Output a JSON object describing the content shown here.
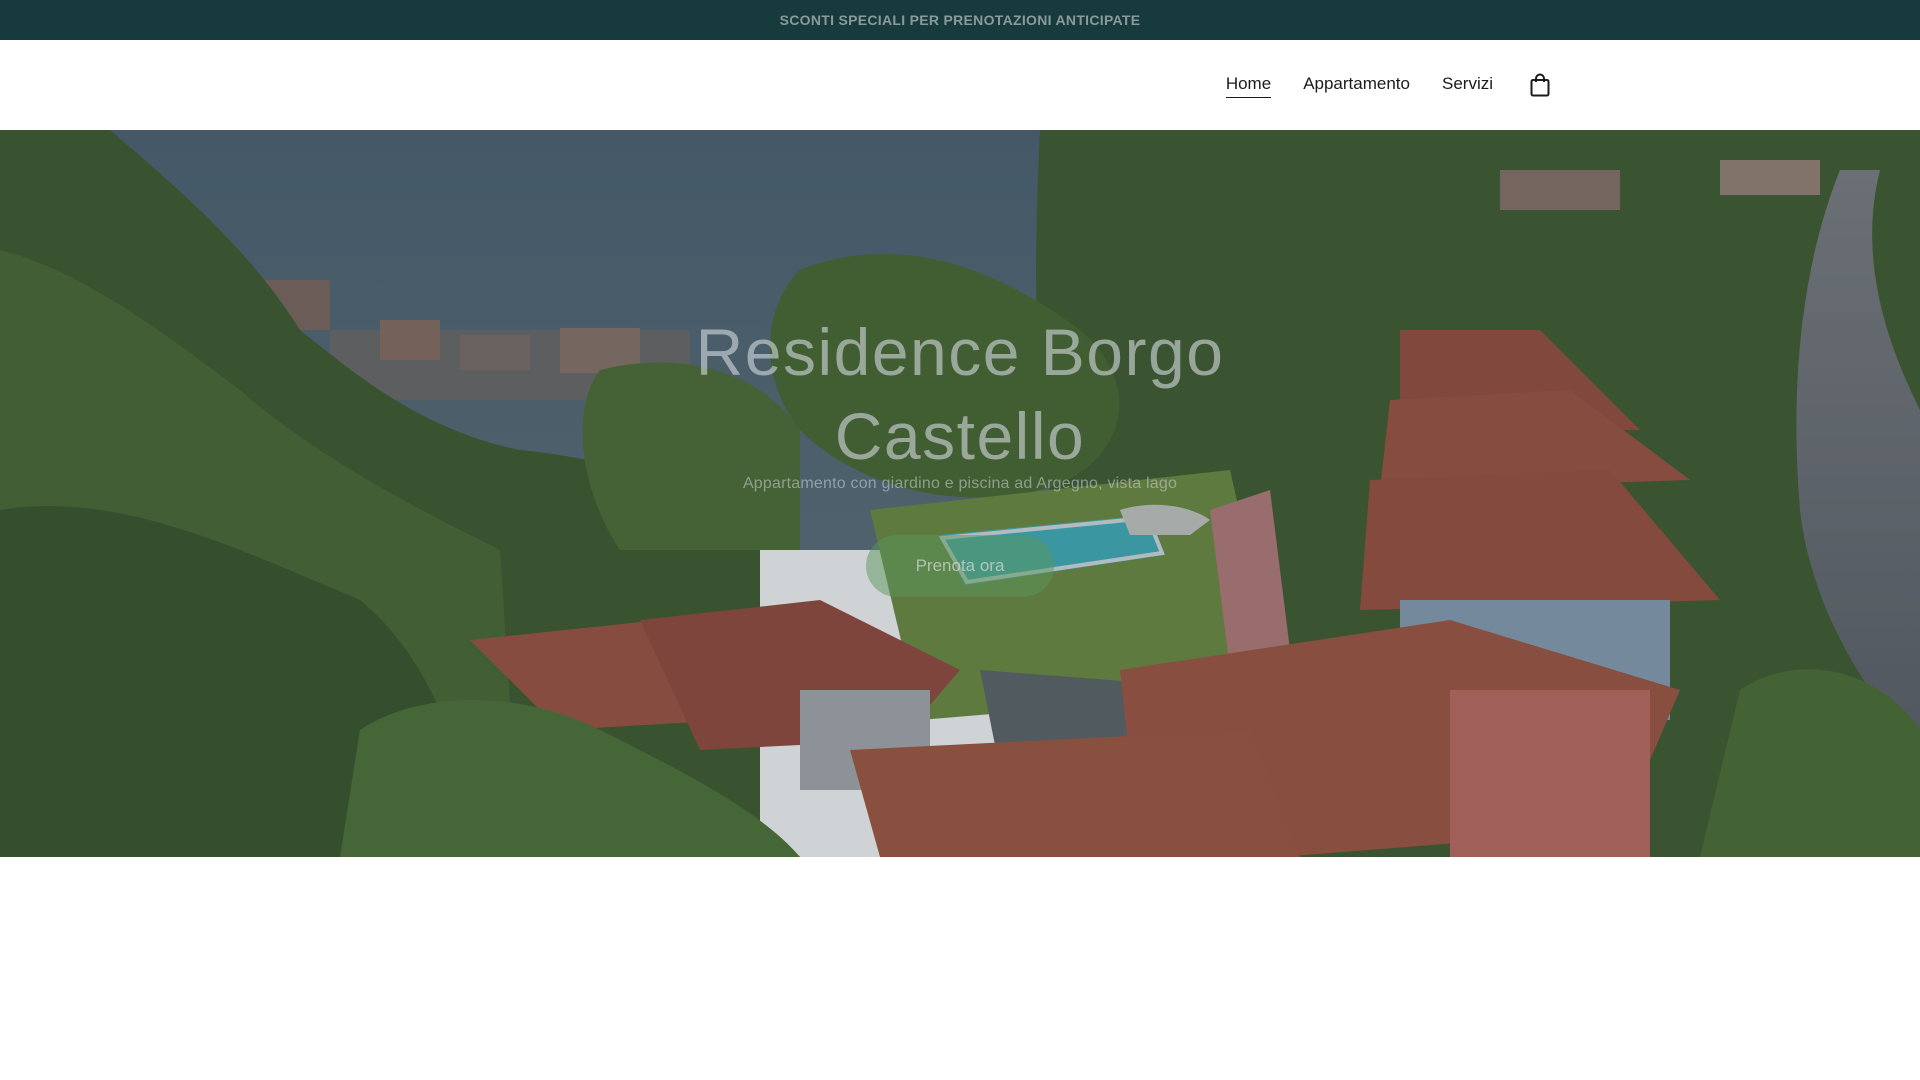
{
  "announcement": {
    "text": "SCONTI SPECIALI PER PRENOTAZIONI ANTICIPATE"
  },
  "nav": {
    "items": [
      {
        "label": "Home",
        "active": true
      },
      {
        "label": "Appartamento",
        "active": false
      },
      {
        "label": "Servizi",
        "active": false
      }
    ],
    "cart_icon": "shopping-bag-icon"
  },
  "hero": {
    "title": "Residence Borgo Castello",
    "subtitle": "Appartamento con giardino e piscina ad Argegno, vista lago",
    "cta_label": "Prenota ora"
  },
  "colors": {
    "announcement_bg": "#173a3c",
    "text_dark": "#1b1b1b",
    "cta_green": "#5c965c"
  }
}
